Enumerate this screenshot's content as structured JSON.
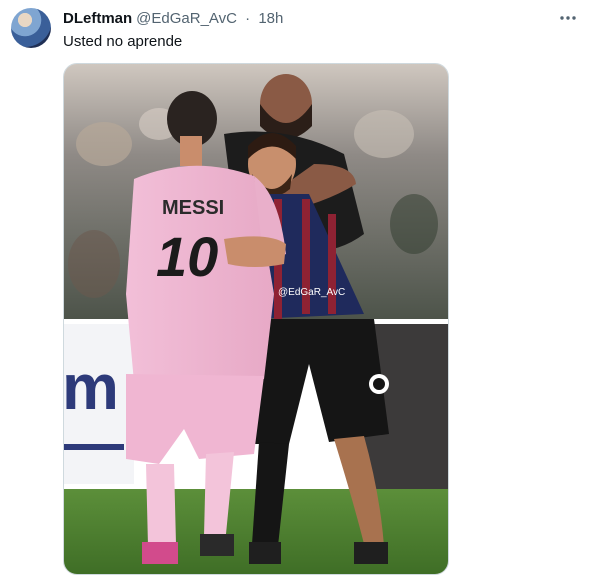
{
  "tweet": {
    "display_name": "DLeftman",
    "handle": "@EdGaR_AvC",
    "separator": "·",
    "time": "18h",
    "text": "Usted no aprende",
    "more_icon": "more-horizontal-icon",
    "media": {
      "jersey_name": "MESSI",
      "jersey_number": "10",
      "watermark": "@EdGaR_AvC",
      "banner_text": "m"
    }
  }
}
